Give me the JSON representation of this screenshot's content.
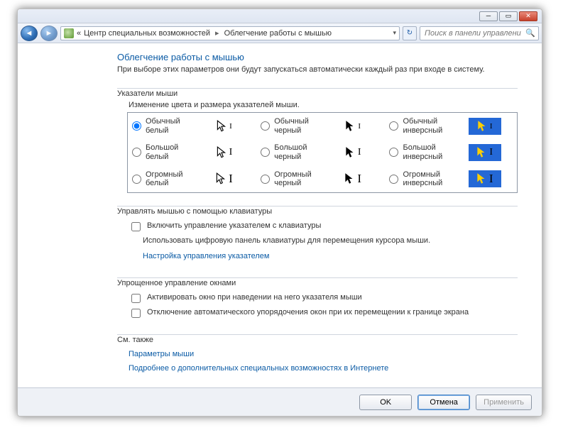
{
  "breadcrumbs": {
    "prefix": "«",
    "item1": "Центр специальных возможностей",
    "item2": "Облегчение работы с мышью"
  },
  "search": {
    "placeholder": "Поиск в панели управления"
  },
  "page": {
    "title": "Облегчение работы с мышью",
    "desc": "При выборе этих параметров они будут запускаться автоматически каждый раз при входе в систему."
  },
  "pointers": {
    "heading": "Указатели мыши",
    "sub": "Изменение цвета и размера указателей мыши.",
    "options": [
      {
        "label": "Обычный\nбелый",
        "selected": true,
        "style": "white"
      },
      {
        "label": "Обычный\nчерный",
        "selected": false,
        "style": "black"
      },
      {
        "label": "Обычный\nинверсный",
        "selected": false,
        "style": "inv"
      },
      {
        "label": "Большой\nбелый",
        "selected": false,
        "style": "white"
      },
      {
        "label": "Большой\nчерный",
        "selected": false,
        "style": "black"
      },
      {
        "label": "Большой\nинверсный",
        "selected": false,
        "style": "inv"
      },
      {
        "label": "Огромный\nбелый",
        "selected": false,
        "style": "white"
      },
      {
        "label": "Огромный\nчерный",
        "selected": false,
        "style": "black"
      },
      {
        "label": "Огромный\nинверсный",
        "selected": false,
        "style": "inv"
      }
    ]
  },
  "keyboard": {
    "heading": "Управлять мышью с помощью клавиатуры",
    "chk": "Включить управление указателем с клавиатуры",
    "desc": "Использовать цифровую панель клавиатуры для перемещения курсора мыши.",
    "link": "Настройка управления указателем"
  },
  "windows": {
    "heading": "Упрощенное управление окнами",
    "chk1": "Активировать окно при наведении на него указателя мыши",
    "chk2": "Отключение автоматического упорядочения окон при их перемещении к границе экрана"
  },
  "seealso": {
    "heading": "См. также",
    "link1": "Параметры мыши",
    "link2": "Подробнее о дополнительных специальных возможностях в Интернете"
  },
  "buttons": {
    "ok": "OK",
    "cancel": "Отмена",
    "apply": "Применить"
  }
}
